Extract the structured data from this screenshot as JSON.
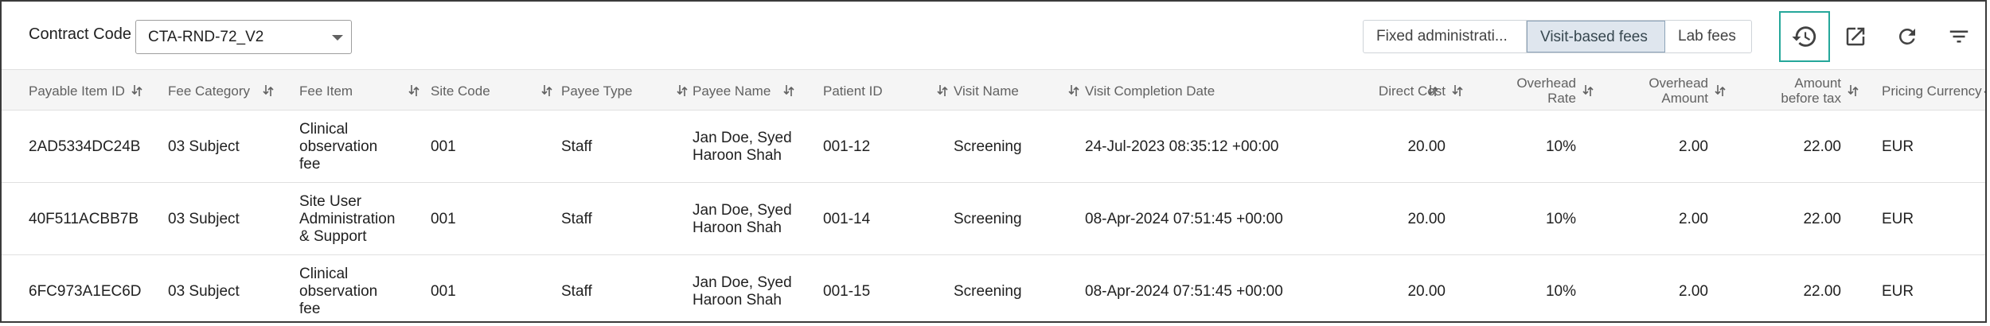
{
  "toolbar": {
    "contract_label": "Contract Code",
    "contract_value": "CTA-RND-72_V2",
    "fee_tabs": [
      "Fixed administrati...",
      "Visit-based fees",
      "Lab fees"
    ],
    "active_tab": "Visit-based fees",
    "icons": [
      "history-icon",
      "open-external-icon",
      "refresh-icon",
      "filter-icon"
    ]
  },
  "table": {
    "headers": {
      "payable_item_id": "Payable Item ID",
      "fee_category": "Fee Category",
      "fee_item": "Fee Item",
      "site_code": "Site Code",
      "payee_type": "Payee Type",
      "payee_name": "Payee Name",
      "patient_id": "Patient ID",
      "visit_name": "Visit Name",
      "visit_completion_date": "Visit Completion Date",
      "direct_cost": "Direct Cost",
      "overhead_rate_1": "Overhead",
      "overhead_rate_2": "Rate",
      "overhead_amount_1": "Overhead",
      "overhead_amount_2": "Amount",
      "amount_before_tax_1": "Amount",
      "amount_before_tax_2": "before tax",
      "pricing_currency": "Pricing Currency"
    },
    "rows": [
      {
        "payable_item_id": "2AD5334DC24B",
        "fee_category": "03 Subject",
        "fee_item": "Clinical observation fee",
        "site_code": "001",
        "payee_type": "Staff",
        "payee_name": "Jan Doe, Syed Haroon Shah",
        "patient_id": "001-12",
        "visit_name": "Screening",
        "visit_completion_date": "24-Jul-2023 08:35:12 +00:00",
        "direct_cost": "20.00",
        "overhead_rate": "10%",
        "overhead_amount": "2.00",
        "amount_before_tax": "22.00",
        "pricing_currency": "EUR"
      },
      {
        "payable_item_id": "40F511ACBB7B",
        "fee_category": "03 Subject",
        "fee_item": "Site User Administration & Support",
        "site_code": "001",
        "payee_type": "Staff",
        "payee_name": "Jan Doe, Syed Haroon Shah",
        "patient_id": "001-14",
        "visit_name": "Screening",
        "visit_completion_date": "08-Apr-2024 07:51:45 +00:00",
        "direct_cost": "20.00",
        "overhead_rate": "10%",
        "overhead_amount": "2.00",
        "amount_before_tax": "22.00",
        "pricing_currency": "EUR"
      },
      {
        "payable_item_id": "6FC973A1EC6D",
        "fee_category": "03 Subject",
        "fee_item": "Clinical observation fee",
        "site_code": "001",
        "payee_type": "Staff",
        "payee_name": "Jan Doe, Syed Haroon Shah",
        "patient_id": "001-15",
        "visit_name": "Screening",
        "visit_completion_date": "08-Apr-2024 07:51:45 +00:00",
        "direct_cost": "20.00",
        "overhead_rate": "10%",
        "overhead_amount": "2.00",
        "amount_before_tax": "22.00",
        "pricing_currency": "EUR"
      }
    ]
  }
}
